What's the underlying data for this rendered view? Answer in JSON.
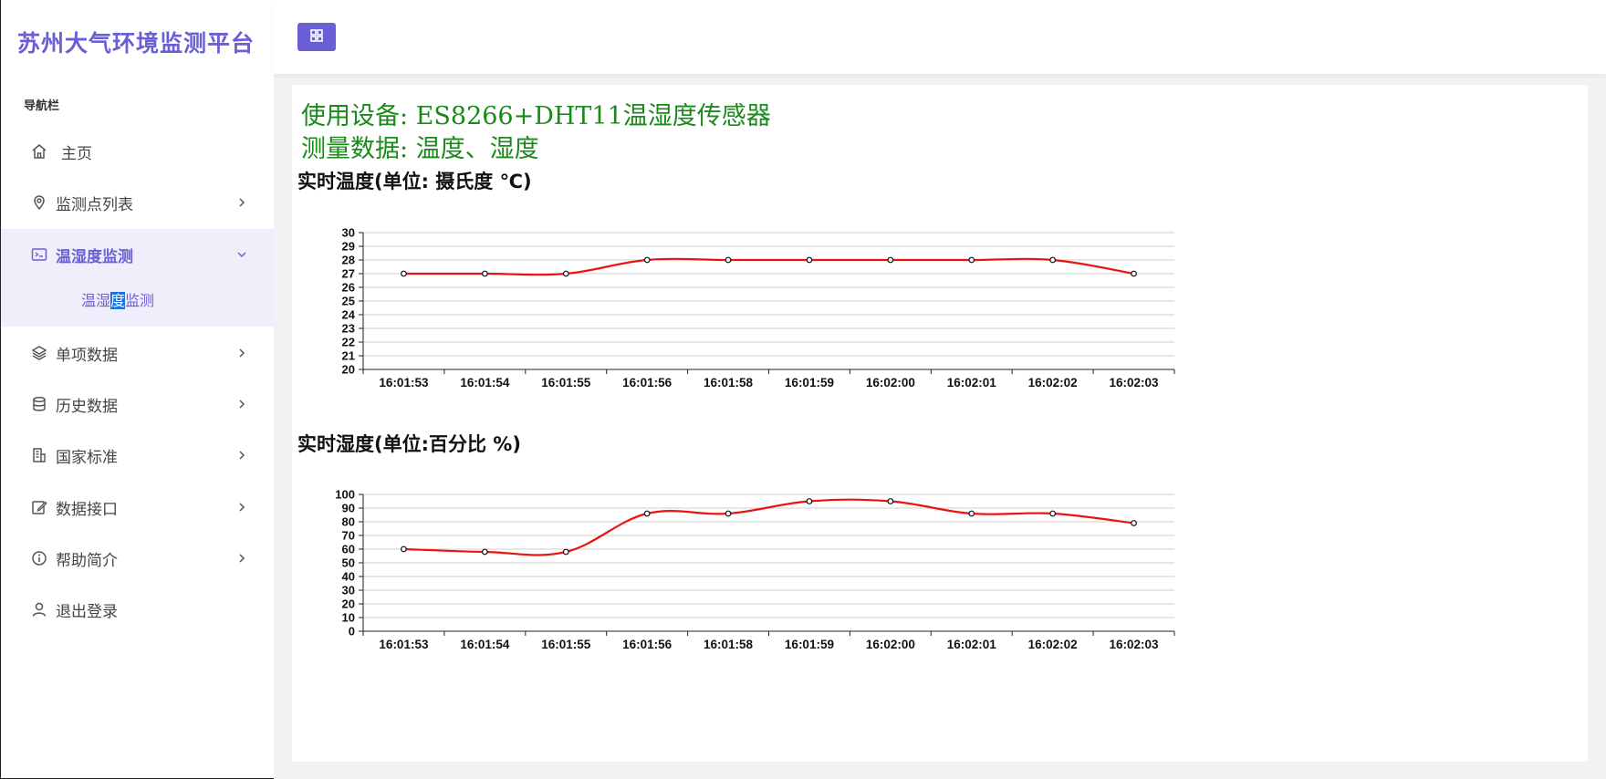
{
  "app": {
    "title": "苏州大气环境监测平台",
    "accent_color": "#6b5fd6"
  },
  "sidebar": {
    "caption": "导航栏",
    "items": [
      {
        "label": "主页",
        "icon": "home-icon",
        "has_children": false
      },
      {
        "label": "监测点列表",
        "icon": "location-pin-icon",
        "has_children": true
      },
      {
        "label": "温湿度监测",
        "icon": "terminal-icon",
        "has_children": true,
        "expanded": true
      },
      {
        "label": "单项数据",
        "icon": "layers-icon",
        "has_children": true
      },
      {
        "label": "历史数据",
        "icon": "database-icon",
        "has_children": true
      },
      {
        "label": "国家标准",
        "icon": "building-icon",
        "has_children": true
      },
      {
        "label": "数据接口",
        "icon": "edit-icon",
        "has_children": true
      },
      {
        "label": "帮助简介",
        "icon": "info-icon",
        "has_children": true
      },
      {
        "label": "退出登录",
        "icon": "user-icon",
        "has_children": false
      }
    ],
    "subitem": {
      "before": "温湿",
      "highlight": "度",
      "after": "监测"
    }
  },
  "topbar": {
    "menu_icon": "grid-icon"
  },
  "main": {
    "device_line": "使用设备: ES8266+DHT11温湿度传感器",
    "measure_line": "测量数据: 温度、湿度",
    "line_color": "#1a8a1a"
  },
  "chart_data": [
    {
      "type": "line",
      "title": "实时温度(单位: 摄氏度 ℃)",
      "categories": [
        "16:01:53",
        "16:01:54",
        "16:01:55",
        "16:01:56",
        "16:01:58",
        "16:01:59",
        "16:02:00",
        "16:02:01",
        "16:02:02",
        "16:02:03"
      ],
      "values": [
        27,
        27,
        27,
        28,
        28,
        28,
        28,
        28,
        28,
        27
      ],
      "ylim": [
        20,
        30
      ],
      "yticks": [
        20,
        21,
        22,
        23,
        24,
        25,
        26,
        27,
        28,
        29,
        30
      ],
      "grid": true,
      "line_color": "#ee1111"
    },
    {
      "type": "line",
      "title": "实时湿度(单位:百分比 %)",
      "categories": [
        "16:01:53",
        "16:01:54",
        "16:01:55",
        "16:01:56",
        "16:01:58",
        "16:01:59",
        "16:02:00",
        "16:02:01",
        "16:02:02",
        "16:02:03"
      ],
      "values": [
        60,
        58,
        58,
        86,
        86,
        95,
        95,
        86,
        86,
        79
      ],
      "ylim": [
        0,
        100
      ],
      "yticks": [
        0,
        10,
        20,
        30,
        40,
        50,
        60,
        70,
        80,
        90,
        100
      ],
      "grid": true,
      "line_color": "#ee1111"
    }
  ]
}
